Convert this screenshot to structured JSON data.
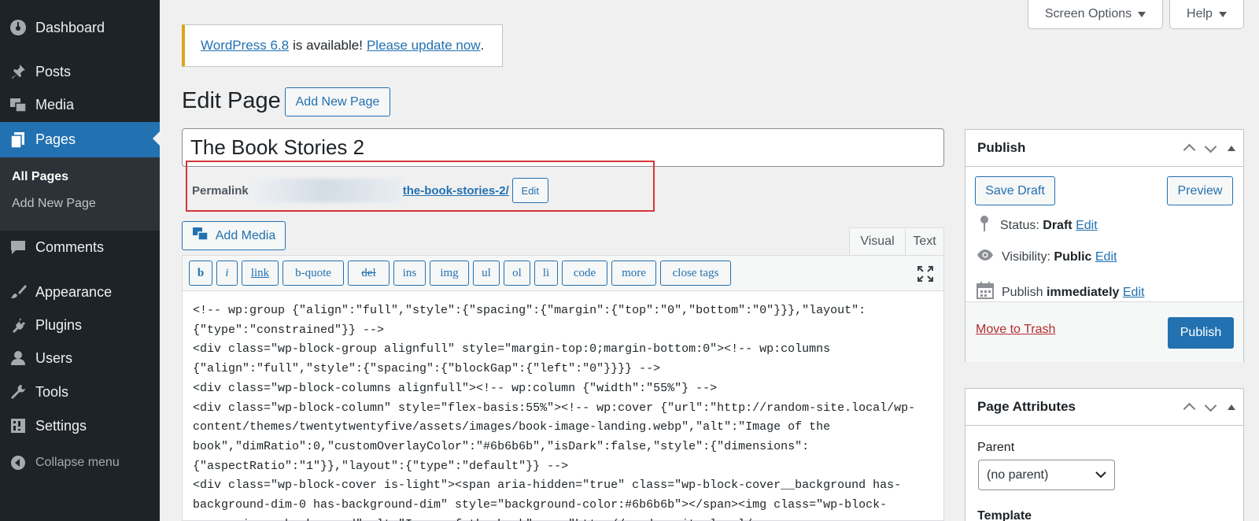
{
  "sidebar": {
    "items": [
      {
        "label": "Dashboard",
        "icon": "dashboard-icon"
      },
      {
        "label": "Posts",
        "icon": "pin-icon"
      },
      {
        "label": "Media",
        "icon": "media-icon"
      },
      {
        "label": "Pages",
        "icon": "pages-icon"
      },
      {
        "label": "Comments",
        "icon": "comment-icon"
      },
      {
        "label": "Appearance",
        "icon": "brush-icon"
      },
      {
        "label": "Plugins",
        "icon": "plug-icon"
      },
      {
        "label": "Users",
        "icon": "user-icon"
      },
      {
        "label": "Tools",
        "icon": "wrench-icon"
      },
      {
        "label": "Settings",
        "icon": "settings-icon"
      }
    ],
    "submenu": [
      "All Pages",
      "Add New Page"
    ],
    "collapse": "Collapse menu"
  },
  "top": {
    "screen_options": "Screen Options",
    "help": "Help"
  },
  "notice": {
    "version_link": "WordPress 6.8",
    "text": "is available!",
    "update_link": "Please update now",
    "end": "."
  },
  "header": {
    "title": "Edit Page",
    "add_new": "Add New Page"
  },
  "post": {
    "title": "The Book Stories 2",
    "permalink_label": "Permalink",
    "permalink_slug": "the-book-stories-2/",
    "permalink_edit": "Edit"
  },
  "editor": {
    "add_media": "Add Media",
    "tabs": [
      "Visual",
      "Text"
    ],
    "quicktags": [
      "b",
      "i",
      "link",
      "b-quote",
      "del",
      "ins",
      "img",
      "ul",
      "ol",
      "li",
      "code",
      "more",
      "close tags"
    ],
    "content": "<!-- wp:group {\"align\":\"full\",\"style\":{\"spacing\":{\"margin\":{\"top\":\"0\",\"bottom\":\"0\"}}},\"layout\":\n{\"type\":\"constrained\"}} -->\n<div class=\"wp-block-group alignfull\" style=\"margin-top:0;margin-bottom:0\"><!-- wp:columns\n{\"align\":\"full\",\"style\":{\"spacing\":{\"blockGap\":{\"left\":\"0\"}}}} -->\n<div class=\"wp-block-columns alignfull\"><!-- wp:column {\"width\":\"55%\"} -->\n<div class=\"wp-block-column\" style=\"flex-basis:55%\"><!-- wp:cover {\"url\":\"http://random-site.local/wp-\ncontent/themes/twentytwentyfive/assets/images/book-image-landing.webp\",\"alt\":\"Image of the\nbook\",\"dimRatio\":0,\"customOverlayColor\":\"#6b6b6b\",\"isDark\":false,\"style\":{\"dimensions\":\n{\"aspectRatio\":\"1\"}},\"layout\":{\"type\":\"default\"}} -->\n<div class=\"wp-block-cover is-light\"><span aria-hidden=\"true\" class=\"wp-block-cover__background has-\nbackground-dim-0 has-background-dim\" style=\"background-color:#6b6b6b\"></span><img class=\"wp-block-\ncover__image-background\" alt=\"Image of the book\" src=\"http://random-site.local/wp-"
  },
  "publish": {
    "title": "Publish",
    "save_draft": "Save Draft",
    "preview": "Preview",
    "status_label": "Status:",
    "status_value": "Draft",
    "visibility_label": "Visibility:",
    "visibility_value": "Public",
    "publish_label": "Publish",
    "publish_value": "immediately",
    "edit": "Edit",
    "trash": "Move to Trash",
    "publish_button": "Publish"
  },
  "attributes": {
    "title": "Page Attributes",
    "parent_label": "Parent",
    "parent_value": "(no parent)",
    "template_label": "Template"
  },
  "colors": {
    "accent": "#2271b1",
    "sidebar": "#1d2327",
    "notice": "#dba617",
    "highlight": "#d63638"
  }
}
